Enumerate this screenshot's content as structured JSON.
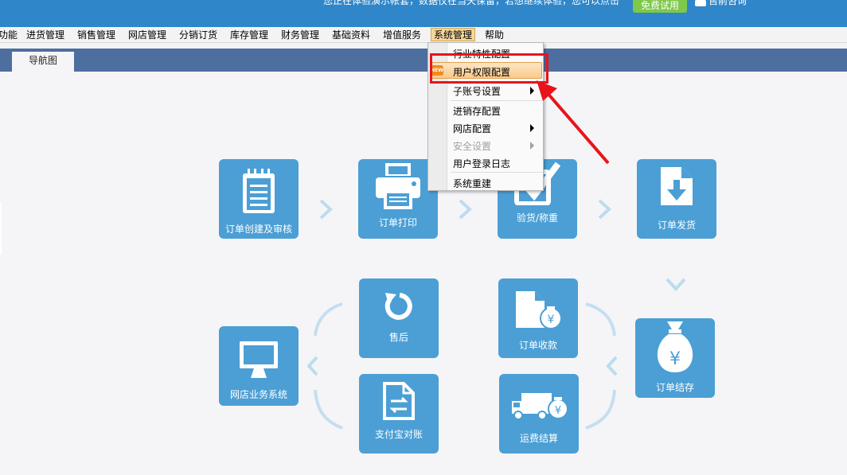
{
  "header": {
    "notice": "您正在体验演示帐套，数据仅在当天保留，若想继续体验，您可以点击",
    "trial_button": "免费试用",
    "consult_label": "售前咨询",
    "consult_icon": "headset-icon"
  },
  "menubar": {
    "items": [
      {
        "label": "功能"
      },
      {
        "label": "进货管理"
      },
      {
        "label": "销售管理"
      },
      {
        "label": "网店管理"
      },
      {
        "label": "分销订货"
      },
      {
        "label": "库存管理"
      },
      {
        "label": "财务管理"
      },
      {
        "label": "基础资料"
      },
      {
        "label": "增值服务"
      },
      {
        "label": "系统管理",
        "active": true
      },
      {
        "label": "帮助"
      }
    ]
  },
  "tabs": {
    "active": "导航图"
  },
  "dropdown": {
    "items": [
      {
        "label": "行业特性配置"
      },
      {
        "label": "用户权限配置",
        "highlighted": true,
        "badge": "NEW"
      },
      {
        "label": "子账号设置",
        "submenu": true
      },
      {
        "label": "进销存配置"
      },
      {
        "label": "网店配置",
        "submenu": true
      },
      {
        "label": "安全设置",
        "submenu": true,
        "disabled": true
      },
      {
        "label": "用户登录日志"
      },
      {
        "label": "系统重建"
      }
    ]
  },
  "flow": {
    "order_create": {
      "label": "订单创建及审核",
      "icon": "notepad-icon"
    },
    "order_print": {
      "label": "订单打印",
      "icon": "printer-icon"
    },
    "inspect": {
      "label": "验货/称重",
      "icon": "checkmark-icon"
    },
    "ship": {
      "label": "订单发货",
      "icon": "document-download-icon"
    },
    "aftersale": {
      "label": "售后",
      "icon": "refresh-icon"
    },
    "payment": {
      "label": "订单收款",
      "icon": "document-money-icon"
    },
    "settle": {
      "label": "订单结存",
      "icon": "money-bag-icon"
    },
    "shop": {
      "label": "网店业务系统",
      "icon": "monitor-icon"
    },
    "alipay": {
      "label": "支付宝对账",
      "icon": "document-transfer-icon"
    },
    "freight": {
      "label": "运费结算",
      "icon": "truck-money-icon"
    }
  },
  "colors": {
    "header_bg": "#2f86c8",
    "card_bg": "#4b9fd5",
    "highlight_border": "#e8141b",
    "trial_button": "#7ec84a"
  }
}
